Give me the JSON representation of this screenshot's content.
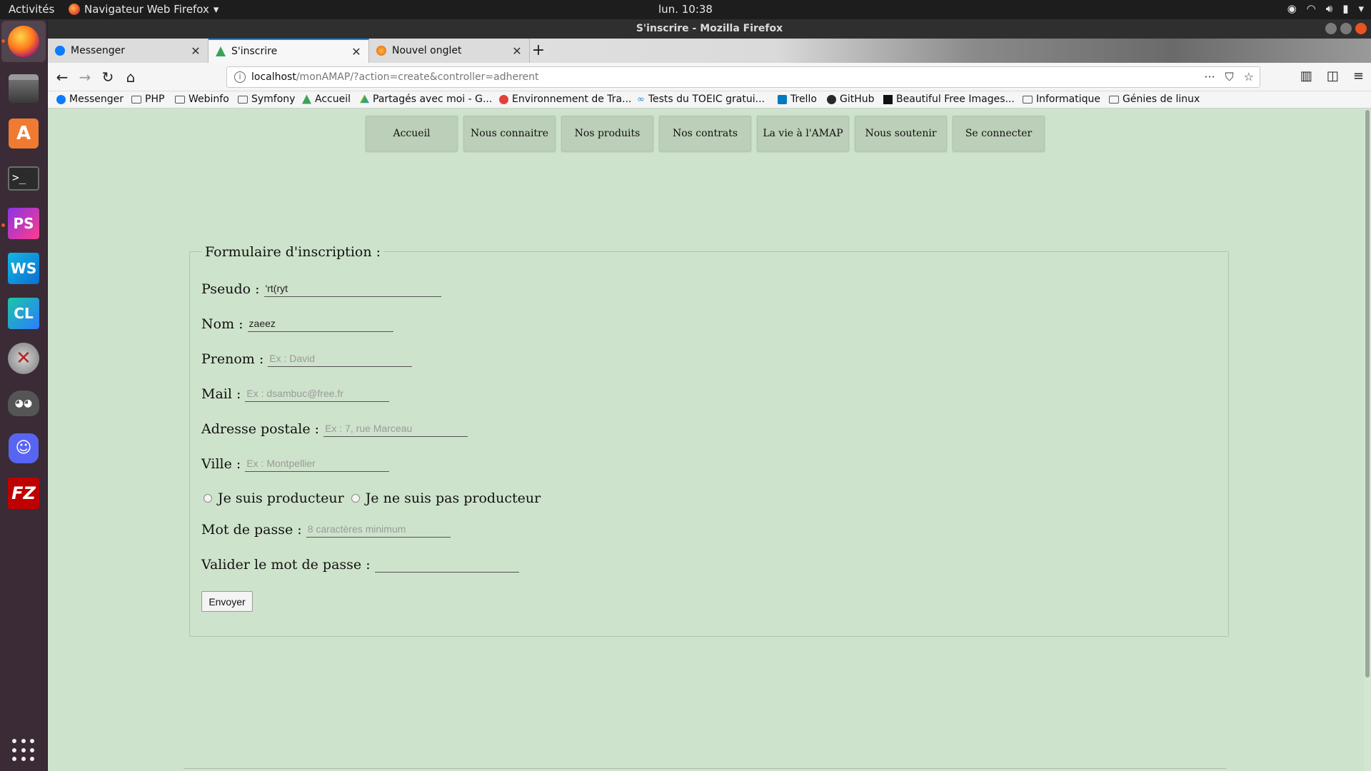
{
  "topbar": {
    "activities": "Activités",
    "app_name": "Navigateur Web Firefox",
    "clock": "lun. 10:38"
  },
  "window": {
    "title": "S'inscrire - Mozilla Firefox"
  },
  "tabs": [
    {
      "label": "Messenger",
      "color": "#0a7cff"
    },
    {
      "label": "S'inscrire",
      "color": "#3aa35a"
    },
    {
      "label": "Nouvel onglet",
      "color": "#e66000"
    }
  ],
  "urlbar": {
    "host": "localhost",
    "path": "/monAMAP/?action=create&controller=adherent"
  },
  "bookmarks": [
    {
      "label": "Messenger",
      "type": "site",
      "color": "#0a7cff"
    },
    {
      "label": "PHP",
      "type": "folder"
    },
    {
      "label": "Webinfo",
      "type": "folder"
    },
    {
      "label": "Symfony",
      "type": "folder"
    },
    {
      "label": "Accueil",
      "type": "site",
      "color": "#3aa35a"
    },
    {
      "label": "Partagés avec moi - G...",
      "type": "site",
      "color": "#fbbc04"
    },
    {
      "label": "Environnement de Tra...",
      "type": "site",
      "color": "#e2403a"
    },
    {
      "label": "Tests du TOEIC gratui...",
      "type": "site",
      "color": "#2a8bd8"
    },
    {
      "label": "Trello",
      "type": "site",
      "color": "#0079bf"
    },
    {
      "label": "GitHub",
      "type": "site",
      "color": "#24292e"
    },
    {
      "label": "Beautiful Free Images...",
      "type": "site",
      "color": "#111111"
    },
    {
      "label": "Informatique",
      "type": "folder"
    },
    {
      "label": "Génies de linux",
      "type": "folder"
    }
  ],
  "menu": [
    "Accueil",
    "Nous connaitre",
    "Nos produits",
    "Nos contrats",
    "La vie à l'AMAP",
    "Nous soutenir",
    "Se connecter"
  ],
  "form": {
    "legend": "Formulaire d'inscription :",
    "pseudo": {
      "label": "Pseudo :",
      "value": "'rt(ryt",
      "placeholder": ""
    },
    "nom": {
      "label": "Nom :",
      "value": "zaeez",
      "placeholder": ""
    },
    "prenom": {
      "label": "Prenom :",
      "value": "",
      "placeholder": "Ex : David"
    },
    "mail": {
      "label": "Mail :",
      "value": "",
      "placeholder": "Ex : dsambuc@free.fr"
    },
    "adresse": {
      "label": "Adresse postale :",
      "value": "",
      "placeholder": "Ex : 7, rue Marceau"
    },
    "ville": {
      "label": "Ville :",
      "value": "",
      "placeholder": "Ex : Montpellier"
    },
    "radio_producteur": "Je suis producteur",
    "radio_non_producteur": "Je ne suis pas producteur",
    "password": {
      "label": "Mot de passe :",
      "value": "",
      "placeholder": "8 caractères minimum"
    },
    "password_confirm": {
      "label": "Valider le mot de passe :",
      "value": "",
      "placeholder": ""
    },
    "submit": "Envoyer"
  },
  "colors": {
    "page_bg": "#cee3cb",
    "menu_btn_bg": "#bccfb8",
    "dock_bg": "#3a2b36",
    "accent": "#e95420"
  },
  "icons": {
    "dock": [
      "firefox-icon",
      "files-icon",
      "software-store-icon",
      "terminal-icon",
      "phpstorm-icon",
      "webstorm-icon",
      "clion-icon",
      "system-tools-icon",
      "gimp-icon",
      "discord-icon",
      "filezilla-icon",
      "app-grid-icon"
    ]
  }
}
